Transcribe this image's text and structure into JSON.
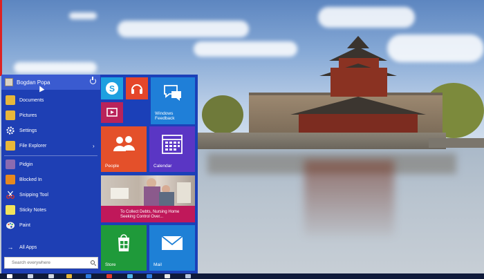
{
  "start_menu": {
    "user": {
      "name": "Bogdan Popa"
    },
    "top_items": [
      {
        "label": "Documents",
        "icon": "folder-icon"
      },
      {
        "label": "Pictures",
        "icon": "folder-icon"
      },
      {
        "label": "Settings",
        "icon": "gear-icon"
      },
      {
        "label": "File Explorer",
        "icon": "folder-icon",
        "submenu_glyph": "›"
      }
    ],
    "apps": [
      {
        "label": "Pidgin",
        "icon": "pidgin-icon"
      },
      {
        "label": "Blocked In",
        "icon": "blocked-in-icon"
      },
      {
        "label": "Snipping Tool",
        "icon": "scissors-icon"
      },
      {
        "label": "Sticky Notes",
        "icon": "sticky-notes-icon"
      },
      {
        "label": "Paint",
        "icon": "palette-icon"
      }
    ],
    "all_apps": {
      "label": "All Apps",
      "glyph": "→"
    },
    "search": {
      "placeholder": "Search everywhere"
    },
    "tiles": {
      "feedback": "Windows Feedback",
      "people": "People",
      "calendar": "Calendar",
      "news": "To Collect Debts, Nursing Home Seeking Control Over...",
      "store": "Store",
      "mail": "Mail"
    }
  },
  "colors": {
    "start_bg": "#1b40b8",
    "skype": "#1da0e0",
    "music": "#e5462a",
    "video": "#b9235a",
    "feedback": "#1f7fd8",
    "people": "#e4502a",
    "calendar": "#5a36c4",
    "news": "#c0185a",
    "store": "#1f9a3a",
    "mail": "#1e80d6"
  }
}
